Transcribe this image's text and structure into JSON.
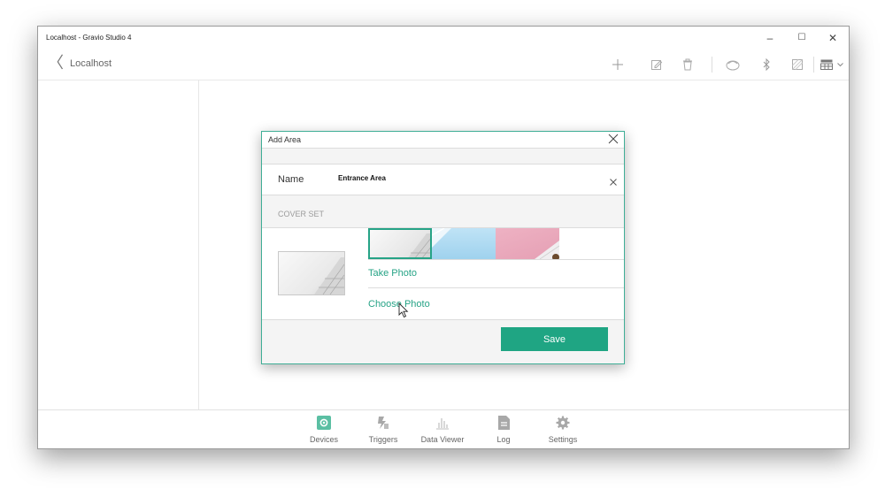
{
  "window": {
    "title": "Localhost - Gravio Studio 4",
    "controls": {
      "minimize": "–",
      "maximize": "☐",
      "close": "✕"
    }
  },
  "toolbar": {
    "back_glyph": "〈",
    "breadcrumb": "Localhost",
    "icons": [
      "add-icon",
      "edit-icon",
      "delete-icon",
      "mqtt-icon",
      "bluetooth-icon",
      "image-icon",
      "grid-view-icon",
      "chevron-down-icon"
    ]
  },
  "dialog": {
    "title": "Add Area",
    "name_label": "Name",
    "name_value": "Entrance Area",
    "section_label": "COVER SET",
    "take_photo": "Take Photo",
    "choose_photo": "Choose Photo",
    "save_label": "Save"
  },
  "bottom_nav": {
    "items": [
      {
        "label": "Devices",
        "icon": "devices-icon",
        "active": true
      },
      {
        "label": "Triggers",
        "icon": "triggers-icon",
        "active": false
      },
      {
        "label": "Data Viewer",
        "icon": "data-viewer-icon",
        "active": false
      },
      {
        "label": "Log",
        "icon": "log-icon",
        "active": false
      },
      {
        "label": "Settings",
        "icon": "settings-icon",
        "active": false
      }
    ]
  },
  "colors": {
    "accent": "#1fa583",
    "dialog_border": "#3fae96",
    "active_nav_icon": "#5bbfa3",
    "inactive_nav_icon": "#a8a8a8"
  }
}
